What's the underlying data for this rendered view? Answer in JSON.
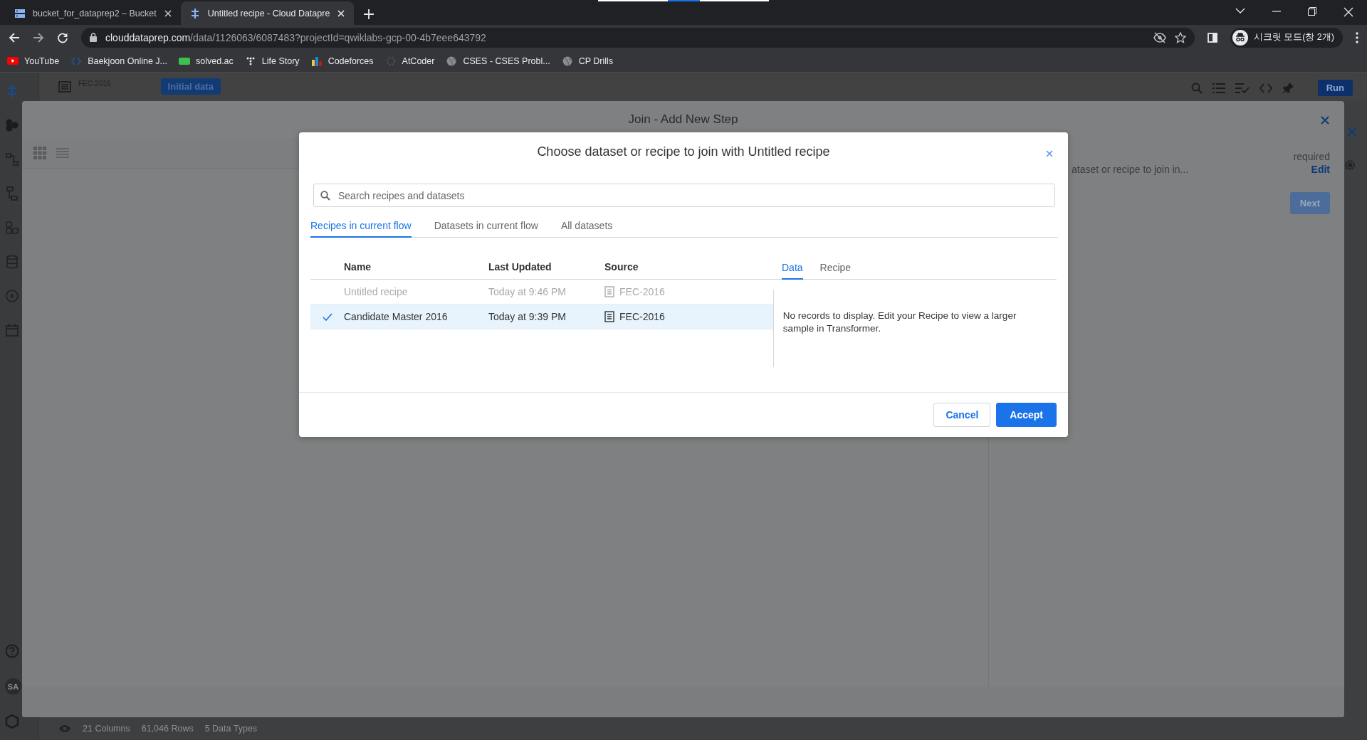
{
  "browser": {
    "tabs": [
      {
        "title": "bucket_for_dataprep2 – Bucket",
        "kind": "storage",
        "selected": false
      },
      {
        "title": "Untitled recipe - Cloud Datapre",
        "kind": "dataprep",
        "selected": true
      }
    ],
    "address": {
      "host": "clouddataprep.com",
      "path": "/data/1126063/6087483?projectId=qwiklabs-gcp-00-4b7eee643792"
    },
    "profile": "시크릿 모드(창 2개)",
    "bookmarks": [
      {
        "label": "YouTube",
        "kind": "video"
      },
      {
        "label": "Baekjoon Online J...",
        "kind": "code"
      },
      {
        "label": "solved.ac",
        "kind": "badge"
      },
      {
        "label": "Life Story",
        "kind": "dots"
      },
      {
        "label": "Codeforces",
        "kind": "bars"
      },
      {
        "label": "AtCoder",
        "kind": "ring"
      },
      {
        "label": "CSES - CSES Probl...",
        "kind": "globe"
      },
      {
        "label": "CP Drills",
        "kind": "globe"
      }
    ]
  },
  "app": {
    "flow": "FEC-2016",
    "initial_data": "Initial data",
    "run": "Run",
    "avatar": "SA",
    "status": [
      "21 Columns",
      "61,046 Rows",
      "5 Data Types"
    ]
  },
  "join_panel": {
    "title": "Join - Add New Step",
    "required": "required",
    "description": "ataset or recipe to join in...",
    "edit": "Edit",
    "next": "Next"
  },
  "dialog": {
    "title": "Choose dataset or recipe to join with Untitled recipe",
    "search": {
      "placeholder": "Search recipes and datasets"
    },
    "tabs": [
      {
        "label": "Recipes in current flow",
        "selected": true
      },
      {
        "label": "Datasets in current flow",
        "selected": false
      },
      {
        "label": "All datasets",
        "selected": false
      }
    ],
    "columns": [
      "Name",
      "Last Updated",
      "Source"
    ],
    "rows": [
      {
        "name": "Untitled recipe",
        "updated": "Today at 9:46 PM",
        "source": "FEC-2016",
        "selected": false,
        "disabled": true
      },
      {
        "name": "Candidate Master 2016",
        "updated": "Today at 9:39 PM",
        "source": "FEC-2016",
        "selected": true,
        "disabled": false
      }
    ],
    "preview_tabs": [
      {
        "label": "Data",
        "selected": true
      },
      {
        "label": "Recipe",
        "selected": false
      }
    ],
    "message": "No records to display. Edit your Recipe to view a larger sample in Transformer.",
    "buttons": [
      {
        "label": "Cancel",
        "kind": "secondary"
      },
      {
        "label": "Accept",
        "kind": "primary"
      }
    ]
  }
}
